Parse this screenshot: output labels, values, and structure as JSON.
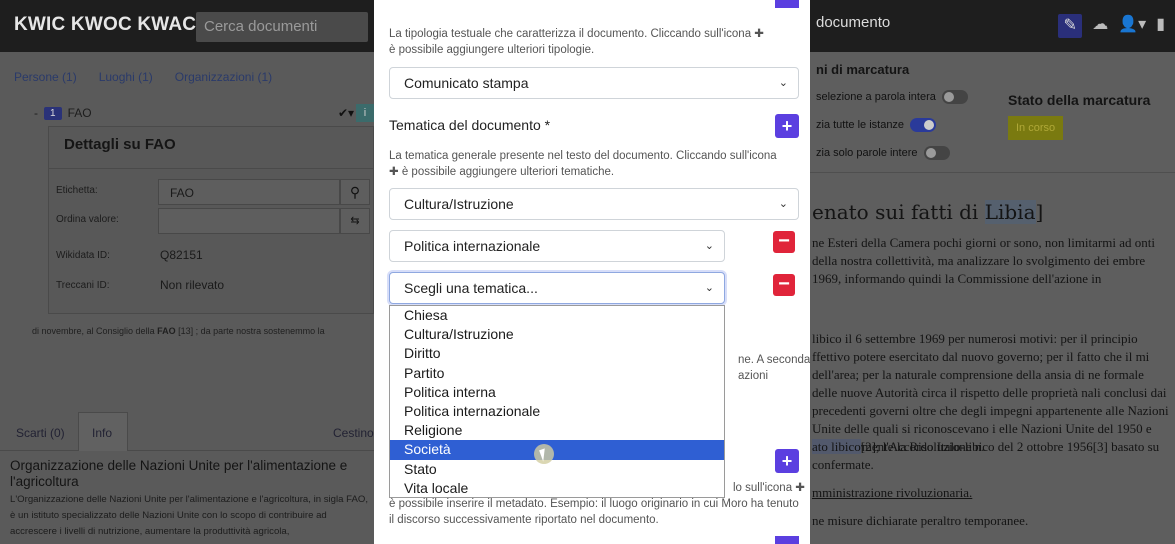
{
  "app": {
    "title": "KWIC KWOC KWAC",
    "search_placeholder": "Cerca documenti",
    "doc_header": "documento"
  },
  "left": {
    "entity_tabs": [
      "Persone (1)",
      "Luoghi (1)",
      "Organizzazioni (1)"
    ],
    "entity_count": "1",
    "entity_name": "FAO",
    "details_title": "Dettagli su FAO",
    "fields": [
      {
        "label": "Etichetta:",
        "value": "FAO"
      },
      {
        "label": "Ordina valore:",
        "value": ""
      },
      {
        "label": "Wikidata ID:",
        "value": "Q82151"
      },
      {
        "label": "Treccani ID:",
        "value": "Non rilevato"
      }
    ],
    "snippet_before": "di novembre, al Consiglio della ",
    "snippet_entity": "FAO",
    "snippet_after": " [13] ; da parte nostra sostenemmo la",
    "bottom_tabs": {
      "scarti": "Scarti (0)",
      "info": "Info",
      "cestino": "Cestino"
    },
    "org_title": "Organizzazione delle Nazioni Unite per l'alimentazione e l'agricoltura",
    "org_desc": "L'Organizzazione delle Nazioni Unite per l'alimentazione e l'agricoltura, in sigla FAO, è un istituto specializzato delle Nazioni Unite con lo scopo di contribuire ad accrescere i livelli di nutrizione, aumentare la produttività agricola,"
  },
  "right": {
    "options_title": "ni di marcatura",
    "opt1": "selezione a parola intera",
    "opt2": "zia tutte le istanze",
    "opt3": "zia solo parole intere",
    "stato_title": "Stato della marcatura",
    "stato_badge": "In corso",
    "heading_before": "enato sui fatti di ",
    "heading_hl": "Libia",
    "heading_after": "]",
    "p1": "ne Esteri della Camera pochi giorni or sono, non limitarmi ad onti della nostra collettività, ma analizzare lo svolgimento dei embre 1969, informando quindi la Commissione dell'azione in",
    "p2": "libico il 6 settembre 1969 per numerosi motivi: per il principio ffettivo potere esercitato dal nuovo governo; per il fatto che il mi dell'area; per la naturale comprensione della ansia di ne formale delle nuove Autorità circa il rispetto delle proprietà nali conclusi dai precedenti governi oltre che degli impegni appartenente alle Nazioni Unite delle quali si riconoscevano i elle Nazioni Unite del 1950 e particolarmente la Risoluzione n.",
    "p2b_hl": "ato libico",
    "p2b_rest": "[2]; l'Accordo Italo-libico del 2 ottobre 1956[3] basato su",
    "p2c": "confermate.",
    "p3": "mministrazione rivoluzionaria.",
    "p4": "ne misure dichiarate peraltro temporanee."
  },
  "modal": {
    "tipologia_desc": "La tipologia testuale che caratterizza il documento. Cliccando sull'icona ✚ è possibile aggiungere ulteriori tipologie.",
    "tipologia_value": "Comunicato stampa",
    "tematica_label": "Tematica del documento *",
    "tematica_desc": "La tematica generale presente nel testo del documento. Cliccando sull'icona ✚ è possibile aggiungere ulteriori tematiche.",
    "tematica_values": [
      "Cultura/Istruzione",
      "Politica internazionale",
      "Scegli una tematica..."
    ],
    "hidden_desc_tail1": "ne. A seconda",
    "hidden_desc_tail2": "azioni",
    "metadata_desc_tail": "lo sull'icona ✚",
    "metadata_desc": "è possibile inserire il metadato. Esempio: il luogo originario in cui Moro ha tenuto il discorso successivamente riportato nel documento.",
    "options": [
      "Chiesa",
      "Cultura/Istruzione",
      "Diritto",
      "Partito",
      "Politica interna",
      "Politica internazionale",
      "Religione",
      "Società",
      "Stato",
      "Vita locale"
    ],
    "selected_index": 7
  }
}
